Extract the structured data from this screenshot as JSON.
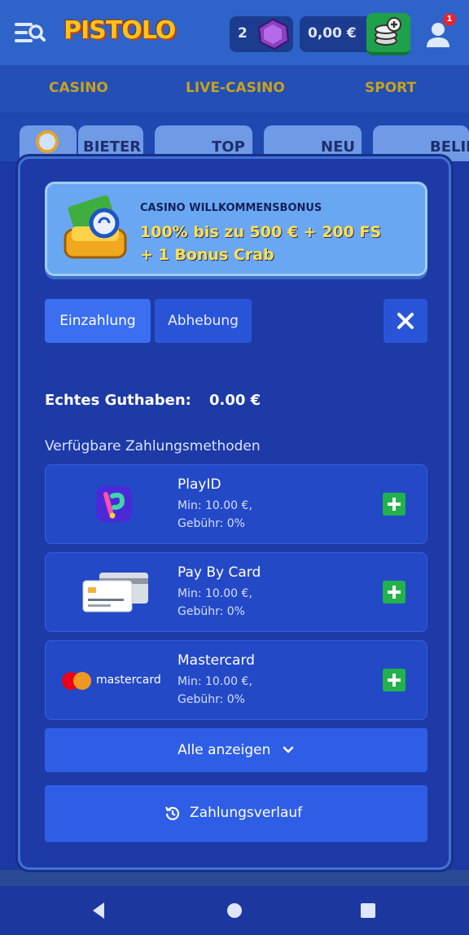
{
  "header": {
    "logo_text": "PISTOLO",
    "gems_count": "2",
    "balance": "0,00 €",
    "notification_count": "1"
  },
  "main_nav": {
    "items": [
      {
        "label": "CASINO"
      },
      {
        "label": "LIVE-CASINO"
      },
      {
        "label": "SPORT"
      }
    ]
  },
  "categories": [
    {
      "label": "BIETER"
    },
    {
      "label": "TOP"
    },
    {
      "label": "NEU"
    },
    {
      "label": "BELIE"
    }
  ],
  "promo": {
    "title": "CASINO WILLKOMMENSBONUS",
    "line1": "100% bis zu 500 € + 200 FS",
    "line2": "+ 1 Bonus Crab"
  },
  "tabs": {
    "deposit": "Einzahlung",
    "withdraw": "Abhebung"
  },
  "balance_section": {
    "label": "Echtes Guthaben:",
    "value": "0.00 €"
  },
  "methods_label": "Verfügbare Zahlungsmethoden",
  "methods": [
    {
      "name": "PlayID",
      "min": "Min: 10.00 €,",
      "fee": "Gebühr: 0%",
      "icon": "playid-logo"
    },
    {
      "name": "Pay By Card",
      "min": "Min: 10.00 €,",
      "fee": "Gebühr: 0%",
      "icon": "card-icon"
    },
    {
      "name": "Mastercard",
      "min": "Min: 10.00 €,",
      "fee": "Gebühr: 0%",
      "icon": "mastercard-logo",
      "logo_text": "mastercard"
    }
  ],
  "show_all_label": "Alle anzeigen",
  "history_label": "Zahlungsverlauf",
  "colors": {
    "accent": "#2f5ee6",
    "plus_green": "#22b14c",
    "promo_yellow": "#ffe14a"
  }
}
